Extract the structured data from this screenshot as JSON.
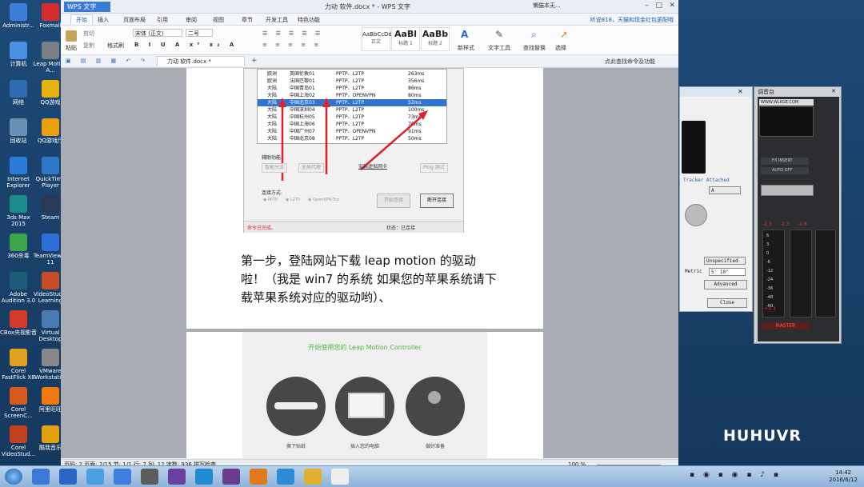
{
  "desktop": {
    "icons_left": [
      {
        "label": "Administr...",
        "color": "#3d7fd6"
      },
      {
        "label": "计算机",
        "color": "#4a90e2"
      },
      {
        "label": "网络",
        "color": "#2f6db3"
      },
      {
        "label": "回收站",
        "color": "#6a8fb5"
      },
      {
        "label": "Internet Explorer",
        "color": "#2a7ad6"
      },
      {
        "label": "3ds Max 2015",
        "color": "#1f8a8a"
      },
      {
        "label": "360杀毒",
        "color": "#3aa54a"
      },
      {
        "label": "Adobe Audition 3.0",
        "color": "#1d5d7a"
      },
      {
        "label": "CBox央视影音",
        "color": "#d23b2a"
      },
      {
        "label": "Corel FastFlick X8",
        "color": "#e0a020"
      },
      {
        "label": "Corel ScreenC...",
        "color": "#d85a1e"
      },
      {
        "label": "Corel VideoStud...",
        "color": "#c04020"
      }
    ],
    "icons_right": [
      {
        "label": "Foxmail",
        "color": "#d22e2e"
      },
      {
        "label": "Leap Motion A...",
        "color": "#7a7f86"
      },
      {
        "label": "QQ游戏",
        "color": "#e5b30e"
      },
      {
        "label": "QQ游戏厅",
        "color": "#e8a010"
      },
      {
        "label": "QuickTime Player",
        "color": "#2d78c6"
      },
      {
        "label": "Steam",
        "color": "#2a3a55"
      },
      {
        "label": "TeamViewer 11",
        "color": "#2d6fd6"
      },
      {
        "label": "VideoStudio Learning",
        "color": "#c44d26"
      },
      {
        "label": "Virtual Desktop",
        "color": "#4a7bb0"
      },
      {
        "label": "VMware Workstati...",
        "color": "#888888"
      },
      {
        "label": "阿里旺旺",
        "color": "#f07a10"
      },
      {
        "label": "酷我音乐",
        "color": "#e2a10d"
      }
    ]
  },
  "wps": {
    "app_name": "WPS 文字",
    "doc_title": "力动 软件.docx * - WPS 文字",
    "account": "懒猫本无...",
    "menu": [
      "开始",
      "插入",
      "页面布局",
      "引用",
      "审阅",
      "视图",
      "章节",
      "开发工具",
      "特色功能"
    ],
    "active_menu": "开始",
    "promo": "听说818，天猫和现金红包更配哦",
    "ribbon": {
      "paste": "粘贴",
      "cut": "剪切",
      "copy": "复制",
      "format_painter": "格式刷",
      "font_name": "宋体 (正文)",
      "font_size": "二号",
      "styles": [
        {
          "sample": "AaBbCcDd",
          "name": "正文"
        },
        {
          "sample": "AaBl",
          "name": "标题 1"
        },
        {
          "sample": "AaBb",
          "name": "标题 2"
        }
      ],
      "new_style": "新样式",
      "text_tools": "文字工具",
      "find_replace": "查找替换",
      "select": "选择"
    },
    "doc_tab": "力动 软件.docx *",
    "search_cmd": "点此查找命令及功能",
    "status": "页码: 2  页面: 2/15  节: 1/1  行: 7  列: 12  字数: 936  拼写检查",
    "zoom": "100 %"
  },
  "screenshot": {
    "rows": [
      {
        "region": "欧洲",
        "server": "英国伦敦01",
        "protocol": "PPTP、L2TP",
        "ping": "263ms"
      },
      {
        "region": "欧洲",
        "server": "法国巴黎01",
        "protocol": "PPTP、L2TP",
        "ping": "356ms"
      },
      {
        "region": "大陆",
        "server": "中国青岛01",
        "protocol": "PPTP、L2TP",
        "ping": "86ms"
      },
      {
        "region": "大陆",
        "server": "中国上海02",
        "protocol": "PPTP、OPENVPN",
        "ping": "80ms"
      },
      {
        "region": "大陆",
        "server": "中国北京03",
        "protocol": "PPTP、L2TP",
        "ping": "52ms"
      },
      {
        "region": "大陆",
        "server": "中国深圳04",
        "protocol": "PPTP、L2TP",
        "ping": "100ms"
      },
      {
        "region": "大陆",
        "server": "中国杭州05",
        "protocol": "PPTP、L2TP",
        "ping": "73ms"
      },
      {
        "region": "大陆",
        "server": "中国上海06",
        "protocol": "PPTP、L2TP",
        "ping": "76ms"
      },
      {
        "region": "大陆",
        "server": "中国广州07",
        "protocol": "PPTP、OPENVPN",
        "ping": "91ms"
      },
      {
        "region": "大陆",
        "server": "中国北京08",
        "protocol": "PPTP、L2TP",
        "ping": "50ms"
      }
    ],
    "selected_index": 4,
    "aux_title": "辅助功能",
    "aux_buttons": [
      "智能分流",
      "全局代理",
      "安装虚拟网卡",
      "Ping 测试"
    ],
    "connect_title": "连接方式:",
    "connect_options": [
      "PPTP",
      "L2TP",
      "OpenVPN-Tcp"
    ],
    "start_btn": "开始连接",
    "stop_btn": "断开连接",
    "cmd_status": "命令已完成。",
    "conn_status": "状态：已连接"
  },
  "paragraph": "第一步，登陆网站下载 leap motion 的驱动啦！（我是 win7 的系统 如果您的苹果系统请下载苹果系统对应的驱动哟）、",
  "leap": {
    "heading": "开始使用您的 Leap Motion Controller",
    "steps": [
      "撕下贴纸",
      "插入您的电脑",
      "做好准备"
    ]
  },
  "tracker": {
    "label": "Tracker Attached",
    "select1": "A",
    "select2": "Unspecified",
    "metric_label": "Metric",
    "metric_value": "5' 10\"",
    "advanced": "Advanced",
    "close": "Close"
  },
  "mixer": {
    "title": "调音台",
    "url": "WWW.WLKGE.COM",
    "fx_insert": "FX INSERT",
    "auto_off": "AUTO OFF",
    "master": "MASTER",
    "meter_values": [
      "-2.3",
      "-2.3",
      "-1.8"
    ],
    "scale": [
      "6",
      "3",
      "0",
      "-6",
      "-12",
      "-24",
      "-36",
      "-48",
      "-60"
    ],
    "foot": "+3.3"
  },
  "taskbar": {
    "time": "14:42",
    "date": "2016/6/12"
  },
  "brand": "HUHUVR"
}
